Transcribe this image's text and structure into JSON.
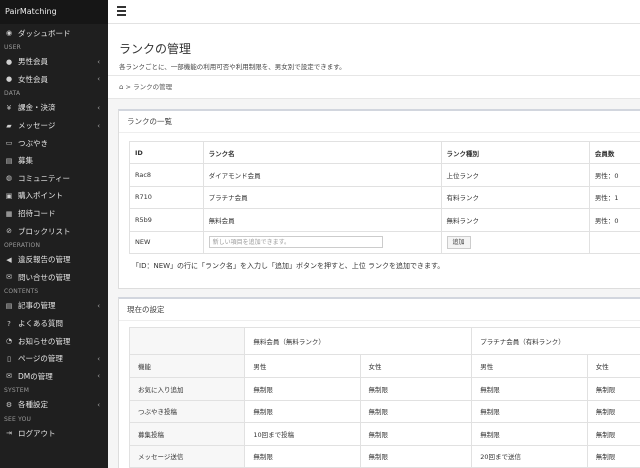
{
  "sidebar": {
    "brand": "PairMatching",
    "sections": {
      "user": "USER",
      "data": "DATA",
      "operation": "OPERATION",
      "contents": "CONTENTS",
      "system": "SYSTEM",
      "seeyou": "SEE YOU"
    },
    "items": {
      "dashboard": "ダッシュボード",
      "male": "男性会員",
      "female": "女性会員",
      "billing": "課金・決済",
      "messages": "メッセージ",
      "tweets": "つぶやき",
      "recruit": "募集",
      "community": "コミュニティー",
      "points": "購入ポイント",
      "invite": "招待コード",
      "blocklist": "ブロックリスト",
      "violation": "違反報告の管理",
      "inquiry": "問い合せの管理",
      "articles": "記事の管理",
      "faq": "よくある質問",
      "notices": "お知らせの管理",
      "pages": "ページの管理",
      "dm": "DMの管理",
      "settings": "各種設定",
      "logout": "ログアウト"
    }
  },
  "page": {
    "title": "ランクの管理",
    "subtitle": "各ランクごとに、一部機能の利用可否や利用制限を、男女別で設定できます。",
    "breadcrumb": "ランクの管理",
    "breadcrumb_sep": ">"
  },
  "rank_list": {
    "title": "ランクの一覧",
    "headers": {
      "id": "ID",
      "name": "ランク名",
      "type": "ランク種別",
      "members": "会員数"
    },
    "rows": [
      {
        "id": "Rac8",
        "name": "ダイアモンド会員",
        "type": "上位ランク",
        "members": "男性：0"
      },
      {
        "id": "R710",
        "name": "プラチナ会員",
        "type": "有料ランク",
        "members": "男性：1"
      },
      {
        "id": "R5b9",
        "name": "無料会員",
        "type": "無料ランク",
        "members": "男性：0"
      }
    ],
    "new_row": {
      "id": "NEW",
      "placeholder": "新しい項目を追加できます。",
      "add_button": "追加"
    },
    "note": "「ID：NEW」の行に「ランク名」を入力し「追加」ボタンを押すと、上位 ランクを追加できます。"
  },
  "current_settings": {
    "title": "現在の設定",
    "groups": [
      "無料会員（無料ランク）",
      "プラチナ会員（有料ランク）"
    ],
    "feature_header": "機能",
    "male": "男性",
    "female": "女性",
    "rows": [
      {
        "feature": "お気に入り追加",
        "values": [
          "無制限",
          "無制限",
          "無制限",
          "無制限"
        ]
      },
      {
        "feature": "つぶやき投稿",
        "values": [
          "無制限",
          "無制限",
          "無制限",
          "無制限"
        ]
      },
      {
        "feature": "募集投稿",
        "values": [
          "10回まで投稿",
          "無制限",
          "無制限",
          "無制限"
        ]
      },
      {
        "feature": "メッセージ送信",
        "values": [
          "無制限",
          "無制限",
          "20回まで送信",
          "無制限"
        ]
      }
    ]
  }
}
